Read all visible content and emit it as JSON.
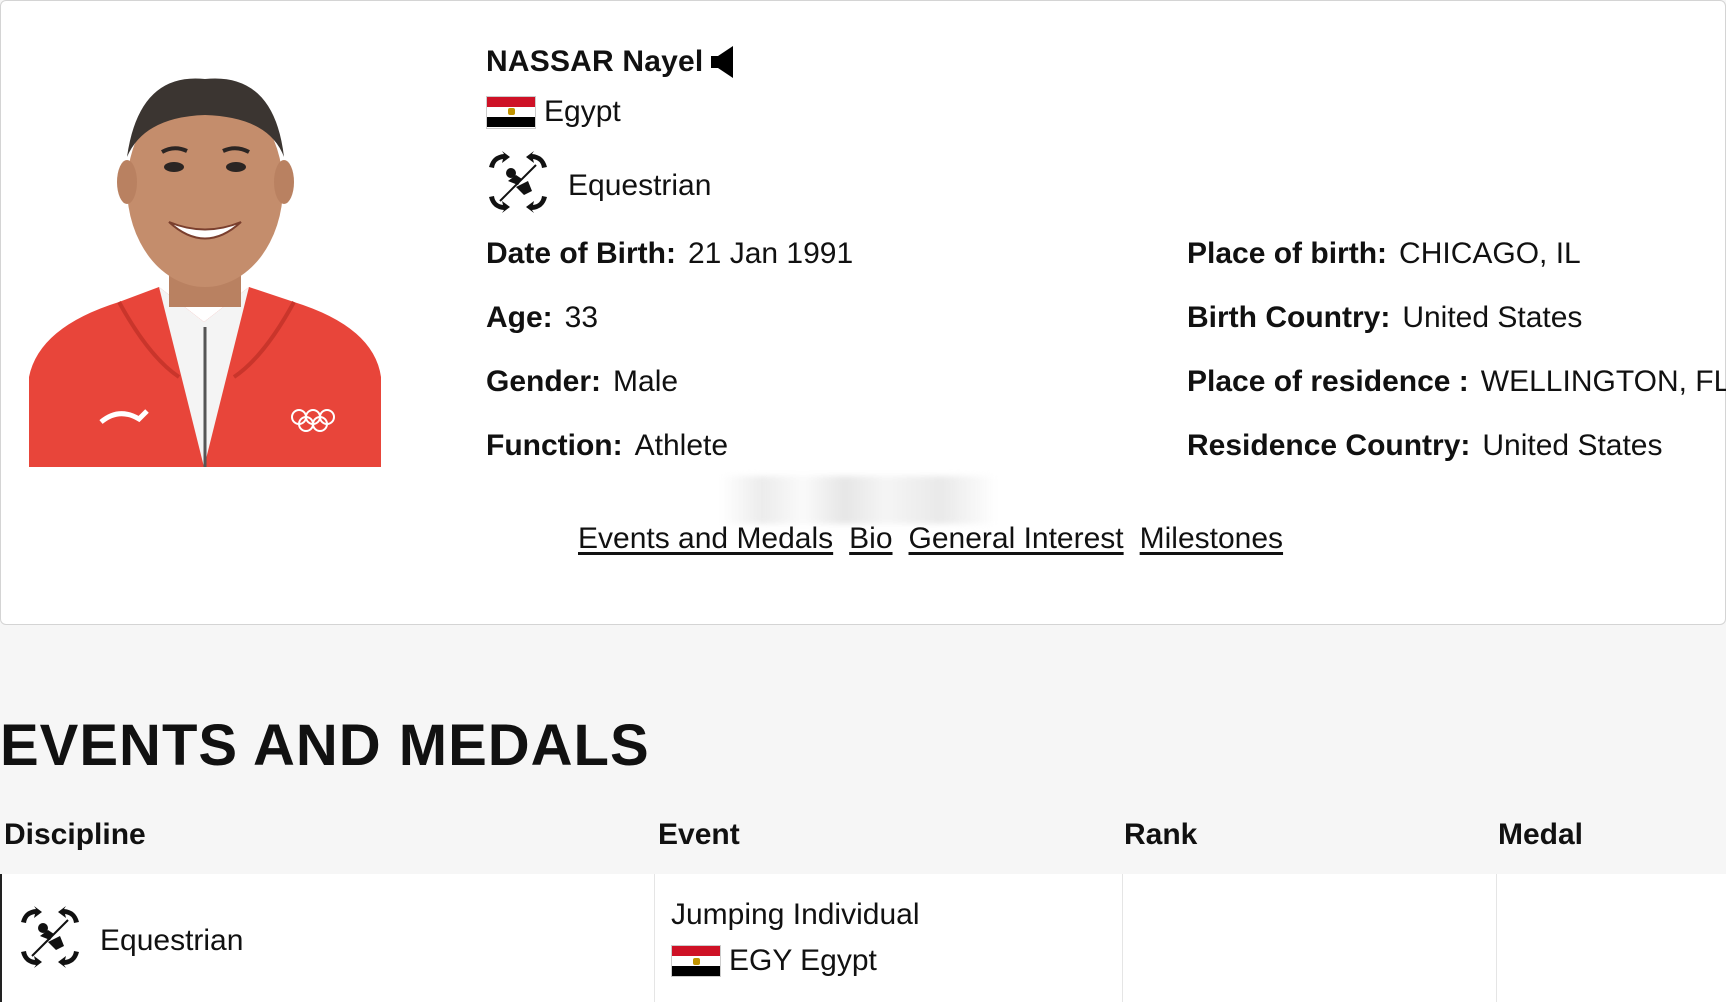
{
  "athlete": {
    "name": "NASSAR Nayel",
    "country": "Egypt",
    "sport": "Equestrian"
  },
  "details_left": [
    {
      "label": "Date of Birth:",
      "value": "21 Jan 1991"
    },
    {
      "label": "Age:",
      "value": "33"
    },
    {
      "label": "Gender:",
      "value": "Male"
    },
    {
      "label": "Function:",
      "value": "Athlete"
    }
  ],
  "details_right": [
    {
      "label": "Place of birth:",
      "value": "CHICAGO, IL"
    },
    {
      "label": "Birth Country:",
      "value": "United States"
    },
    {
      "label": "Place of residence :",
      "value": "WELLINGTON, FL"
    },
    {
      "label": "Residence Country:",
      "value": "United States"
    }
  ],
  "nav_links": [
    "Events and Medals",
    "Bio",
    "General Interest",
    "Milestones"
  ],
  "section_title": "EVENTS AND MEDALS",
  "table": {
    "headers": [
      "Discipline",
      "Event",
      "Rank",
      "Medal"
    ],
    "rows": [
      {
        "discipline": "Equestrian",
        "event": "Jumping Individual",
        "noc": "EGY Egypt",
        "rank": "",
        "medal": ""
      }
    ]
  },
  "colors": {
    "flag_red": "#ce1126",
    "flag_black": "#000000",
    "jacket_red": "#e8453a"
  },
  "icons": [
    "speaker-icon",
    "egypt-flag-icon",
    "equestrian-pictogram-icon"
  ]
}
